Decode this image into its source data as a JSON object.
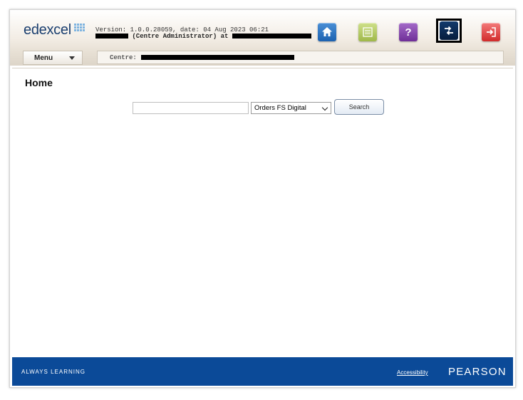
{
  "header": {
    "logo_text": "edexcel",
    "version_line": "Version: 1.0.0.28059, date: 04 Aug 2023 06:21",
    "role_text": "(Centre Administrator) at",
    "buttons": {
      "home_icon": "home-icon",
      "notes_icon": "notepad-icon",
      "help_text": "?",
      "switch_icon": "switch-arrows-icon",
      "logout_icon": "logout-icon"
    }
  },
  "subbar": {
    "menu_label": "Menu",
    "centre_label": "Centre:"
  },
  "main": {
    "title": "Home",
    "search": {
      "value": "",
      "placeholder": "",
      "type_selected": "Orders FS Digital",
      "button_label": "Search"
    }
  },
  "footer": {
    "tagline": "ALWAYS LEARNING",
    "accessibility_link": "Accessibility",
    "brand": "PEARSON"
  },
  "colors": {
    "footer_blue": "#0b4a98",
    "logo_blue": "#1a3e6f"
  }
}
